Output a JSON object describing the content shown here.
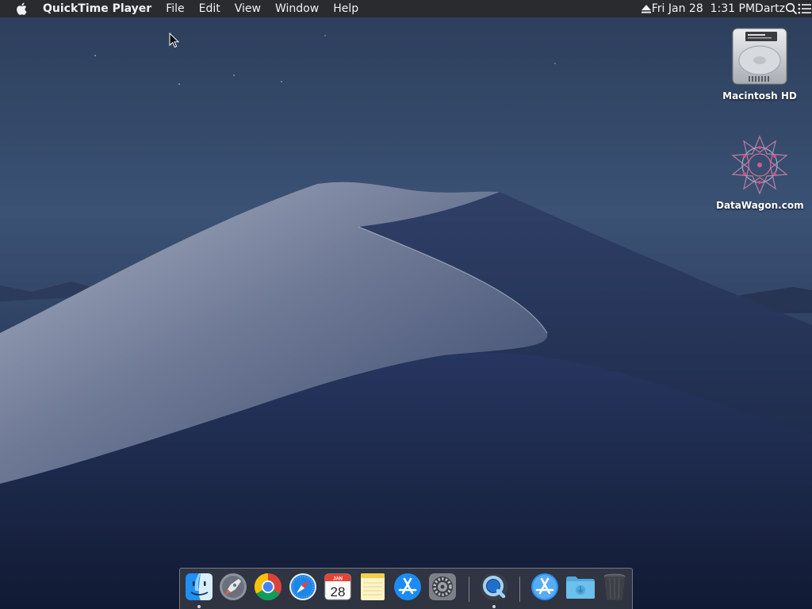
{
  "menubar": {
    "app_name": "QuickTime Player",
    "menus": [
      "File",
      "Edit",
      "View",
      "Window",
      "Help"
    ],
    "clock": "Fri Jan 28  1:31 PM",
    "user": "Dartz",
    "icons": [
      "apple-logo-icon",
      "eject-icon",
      "spotlight-search-icon",
      "notification-center-icon"
    ]
  },
  "desktop": {
    "icons": [
      {
        "label": "Macintosh HD",
        "icon": "hard-drive-icon"
      },
      {
        "label": "DataWagon.com",
        "icon": "datawagon-logo-icon"
      }
    ]
  },
  "dock": {
    "calendar_month": "JAN",
    "calendar_day": "28",
    "items": [
      {
        "name": "finder",
        "icon": "finder-icon",
        "running": true
      },
      {
        "name": "launchpad",
        "icon": "launchpad-icon",
        "running": false
      },
      {
        "name": "chrome",
        "icon": "chrome-icon",
        "running": false
      },
      {
        "name": "safari",
        "icon": "safari-icon",
        "running": false
      },
      {
        "name": "calendar",
        "icon": "calendar-icon",
        "running": false
      },
      {
        "name": "notes",
        "icon": "notes-icon",
        "running": false
      },
      {
        "name": "app-store",
        "icon": "app-store-icon",
        "running": false
      },
      {
        "name": "system-preferences",
        "icon": "system-preferences-icon",
        "running": false
      },
      {
        "name": "quicktime",
        "icon": "quicktime-icon",
        "running": true
      },
      {
        "name": "applications",
        "icon": "applications-folder-icon",
        "running": false
      },
      {
        "name": "downloads",
        "icon": "downloads-folder-icon",
        "running": false
      },
      {
        "name": "trash",
        "icon": "trash-icon",
        "running": false
      }
    ]
  },
  "colors": {
    "menubar_bg": "#2a2b2f",
    "menubar_text": "#f2f2f2",
    "sky_top": "#3a5070",
    "dune_light": "#9aa3b8",
    "dune_dark": "#1c2a4a"
  }
}
